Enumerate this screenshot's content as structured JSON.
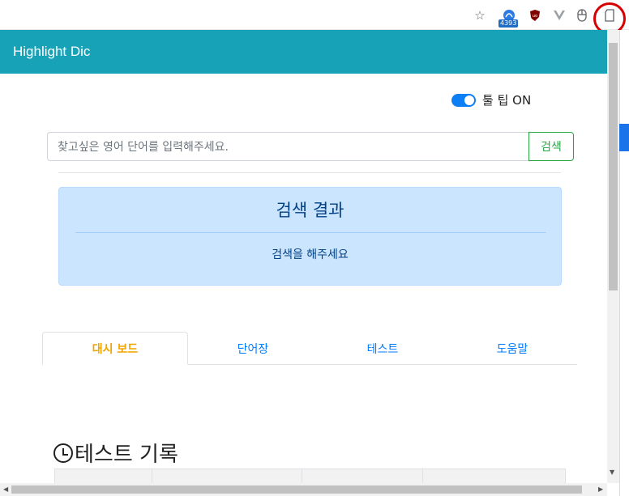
{
  "toolbar": {
    "badge_count": "4393",
    "icons": [
      "star-icon",
      "extension-badge-icon",
      "ublock-icon",
      "vue-devtools-icon",
      "mouse-icon",
      "highlight-dic-extension-icon"
    ]
  },
  "popup": {
    "title": "Highlight Dic",
    "header_color": "#17a2b8",
    "tooltip": {
      "label": "툴 팁 ON",
      "enabled": true
    },
    "search": {
      "placeholder": "찾고싶은 영어 단어를 입력해주세요.",
      "button": "검색"
    },
    "result": {
      "title": "검색 결과",
      "message": "검색을 해주세요"
    },
    "tabs": [
      {
        "label": "대시 보드",
        "active": true
      },
      {
        "label": "단어장",
        "active": false
      },
      {
        "label": "테스트",
        "active": false
      },
      {
        "label": "도움말",
        "active": false
      }
    ],
    "history": {
      "title": "테스트 기록"
    }
  },
  "colors": {
    "accent": "#17a2b8",
    "active_tab": "#f0a500",
    "link": "#007bff",
    "success": "#28a745"
  }
}
